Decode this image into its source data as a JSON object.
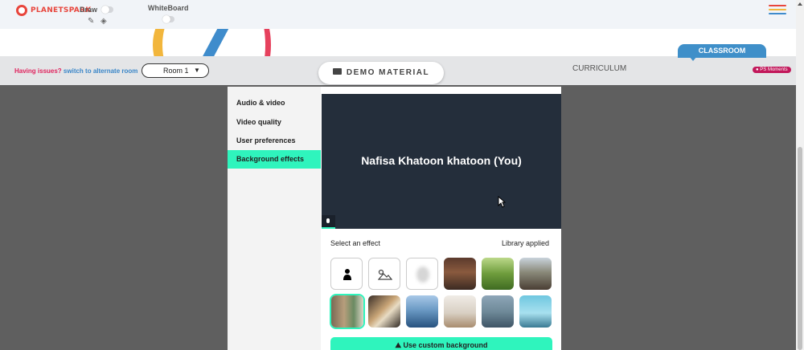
{
  "topbar": {
    "logo": "PLANETSPARK",
    "draw_label": "Draw",
    "whiteboard_label": "WhiteBoard"
  },
  "info_bar": {
    "issues_text": "Having issues?",
    "alt_room_link": "switch to alternate room",
    "room_value": "Room 1",
    "demo_material_label": "DEMO MATERIAL",
    "curriculum_label": "CURRICULUM",
    "classroom_tab": "CLASSROOM",
    "ps_moments": "PS Moments"
  },
  "settings": {
    "menu": [
      {
        "label": "Audio & video"
      },
      {
        "label": "Video quality"
      },
      {
        "label": "User preferences"
      },
      {
        "label": "Background effects"
      }
    ],
    "active_item": "Background effects",
    "preview_name": "Nafisa Khatoon khatoon (You)",
    "select_effect_label": "Select an effect",
    "library_applied_label": "Library applied",
    "effects": [
      {
        "name": "none"
      },
      {
        "name": "slight blur"
      },
      {
        "name": "blur"
      },
      {
        "name": "brick room"
      },
      {
        "name": "green park"
      },
      {
        "name": "mountain sunset"
      },
      {
        "name": "bookshelf"
      },
      {
        "name": "loft"
      },
      {
        "name": "ocean"
      },
      {
        "name": "white room"
      },
      {
        "name": "agave plant"
      },
      {
        "name": "beach pier"
      }
    ],
    "custom_bg_button": "Use custom background"
  },
  "colors": {
    "accent": "#2ff4bd",
    "preview_bg": "#242e3b",
    "brand_red": "#e8453c",
    "brand_blue": "#3a86c8",
    "classroom_blue": "#3f8fc9",
    "ps_moments": "#c2185b"
  }
}
